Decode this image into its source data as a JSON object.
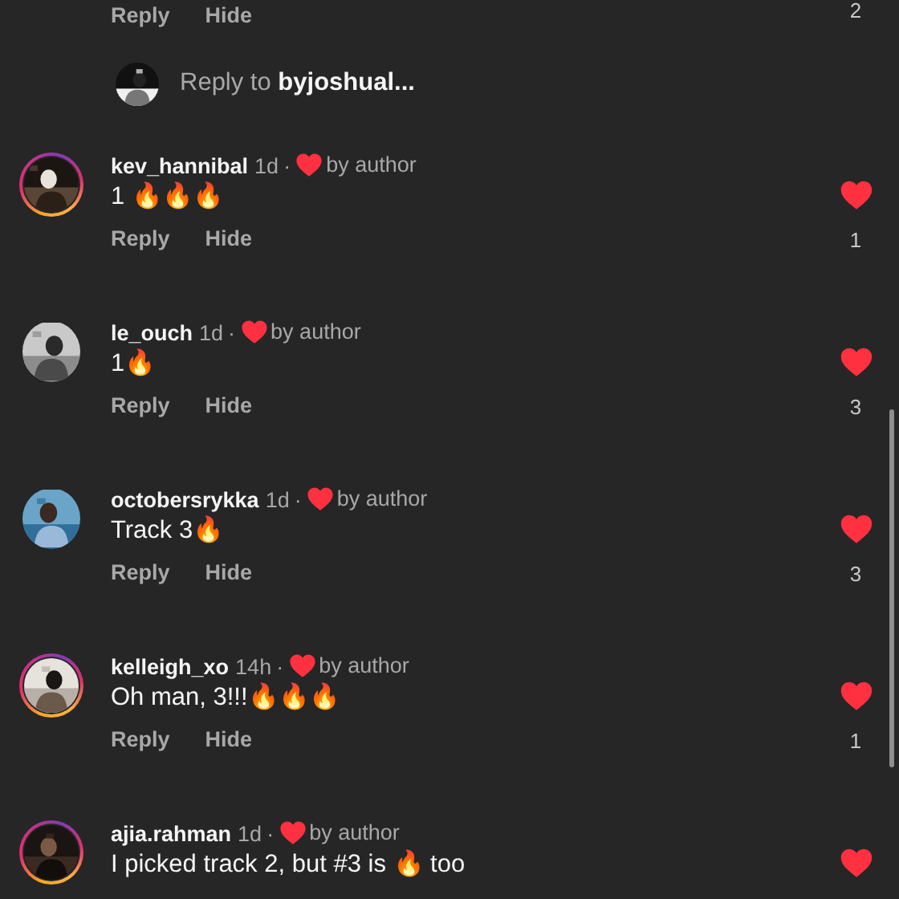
{
  "top_actions": {
    "reply": "Reply",
    "hide": "Hide",
    "like_count": "2"
  },
  "reply_prompt": "Reply to **byjoshual...**",
  "comments": [
    {
      "username": "kev_hannibal",
      "time": "1d",
      "separator": "·",
      "author_liked": true,
      "author_label": "by author",
      "text": "1 🔥🔥🔥",
      "reply": "Reply",
      "hide": "Hide",
      "liked": true,
      "like_count": "1",
      "story_ring": true
    },
    {
      "username": "le_ouch",
      "time": "1d",
      "separator": "·",
      "author_liked": true,
      "author_label": "by author",
      "text": "1🔥",
      "reply": "Reply",
      "hide": "Hide",
      "liked": true,
      "like_count": "3",
      "story_ring": false
    },
    {
      "username": "octobersrykka",
      "time": "1d",
      "separator": "·",
      "author_liked": true,
      "author_label": "by author",
      "text": "Track 3🔥",
      "reply": "Reply",
      "hide": "Hide",
      "liked": true,
      "like_count": "3",
      "story_ring": false
    },
    {
      "username": "kelleigh_xo",
      "time": "14h",
      "separator": "·",
      "author_liked": true,
      "author_label": "by author",
      "text": "Oh man, 3!!!🔥🔥🔥",
      "reply": "Reply",
      "hide": "Hide",
      "liked": true,
      "like_count": "1",
      "story_ring": true
    },
    {
      "username": "ajia.rahman",
      "time": "1d",
      "separator": "·",
      "author_liked": true,
      "author_label": "by author",
      "text": "I picked track 2, but #3 is 🔥 too",
      "liked": true,
      "story_ring": true
    }
  ]
}
